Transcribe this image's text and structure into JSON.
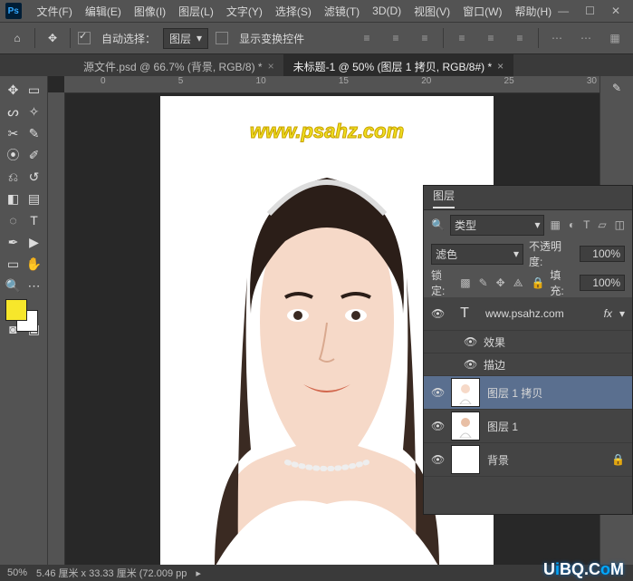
{
  "menu": {
    "file": "文件(F)",
    "edit": "编辑(E)",
    "image": "图像(I)",
    "layer": "图层(L)",
    "text": "文字(Y)",
    "select": "选择(S)",
    "filter": "滤镜(T)",
    "threed": "3D(D)",
    "view": "视图(V)",
    "window": "窗口(W)",
    "help": "帮助(H)"
  },
  "optbar": {
    "auto_select": "自动选择：",
    "auto_select_target": "图层",
    "show_transform": "显示变换控件"
  },
  "tabs": [
    {
      "label": "源文件.psd @ 66.7% (背景, RGB/8) *",
      "active": false
    },
    {
      "label": "未标题-1 @ 50% (图层 1 拷贝, RGB/8#) *",
      "active": true
    }
  ],
  "ruler_ticks": [
    "0",
    "5",
    "10",
    "15",
    "20",
    "25",
    "30"
  ],
  "watermark": "www.psahz.com",
  "layers_panel": {
    "title": "图层",
    "filter_label": "类型",
    "blend_mode": "滤色",
    "opacity_label": "不透明度:",
    "opacity_value": "100%",
    "lock_label": "锁定:",
    "fill_label": "填充:",
    "fill_value": "100%",
    "items": [
      {
        "kind": "text",
        "label": "www.psahz.com",
        "fx": "fx"
      },
      {
        "kind": "fxhdr",
        "label": "效果"
      },
      {
        "kind": "fx",
        "label": "描边"
      },
      {
        "kind": "img",
        "label": "图层 1 拷贝",
        "selected": true
      },
      {
        "kind": "img",
        "label": "图层 1"
      },
      {
        "kind": "bg",
        "label": "背景",
        "locked": true
      }
    ]
  },
  "status": {
    "zoom": "50%",
    "dims": "5.46 厘米 x 33.33 厘米 (72.009 pp",
    "arrow": "▸"
  },
  "footer": "UiBQ.CoM"
}
